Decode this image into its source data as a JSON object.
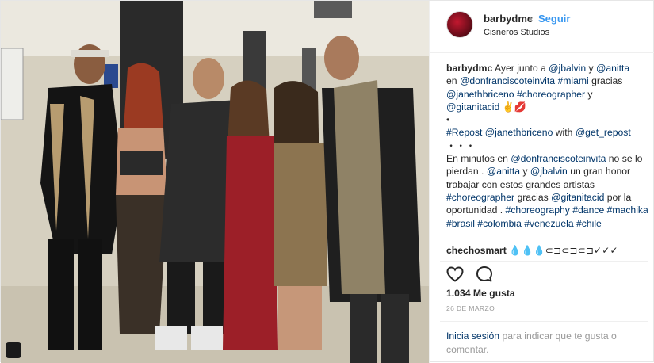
{
  "post": {
    "username": "barbydmc",
    "dot": "•",
    "follow_label": "Seguir",
    "location": "Cisneros Studios"
  },
  "caption": {
    "line1_user": "barbydmc",
    "line1_text": " Ayer junto a ",
    "m1": "@jbalvin",
    "t1": " y ",
    "m2": "@anitta",
    "t2": "en ",
    "m3": "@donfranciscoteinvita",
    "h1": "#miami",
    "t3": " gracias",
    "m4": "@janethbriceno",
    "h2": "#choreographer",
    "t4": " y",
    "m5": "@gitanitacid",
    "emoji1": " ✌💋",
    "bullet": "•",
    "h3": "#Repost",
    "m6": "@janethbriceno",
    "t5": " with ",
    "m7": "@get_repost",
    "dots": "・・・",
    "p2a": "En minutos en ",
    "m8": "@donfranciscoteinvita",
    "p2b": " no se lo pierdan . ",
    "m9": "@anitta",
    "p2c": " y ",
    "m10": "@jbalvin",
    "p2d": " un gran honor trabajar con estos grandes artistas ",
    "h4": "#choreographer",
    "p2e": " gracias ",
    "m11": "@gitanitacid",
    "p2f": " por la oportunidad . ",
    "h5": "#choreography",
    "h6": "#dance",
    "h7": "#machika",
    "h8": "#brasil",
    "h9": "#colombia",
    "h10": "#venezuela",
    "h11": "#chile"
  },
  "comment": {
    "user": "chechosmart",
    "text": "💧💧💧⊂⊐⊂⊐⊂⊐✓✓✓"
  },
  "stats": {
    "likes": "1.034 Me gusta",
    "date": "26 DE MARZO"
  },
  "login": {
    "link": "Inicia sesión",
    "rest": " para indicar que te gusta o comentar."
  },
  "colors": {
    "link": "#003569",
    "follow": "#3897f0",
    "muted": "#999999"
  },
  "icons": {
    "heart": "heart-icon",
    "comment": "comment-icon"
  }
}
